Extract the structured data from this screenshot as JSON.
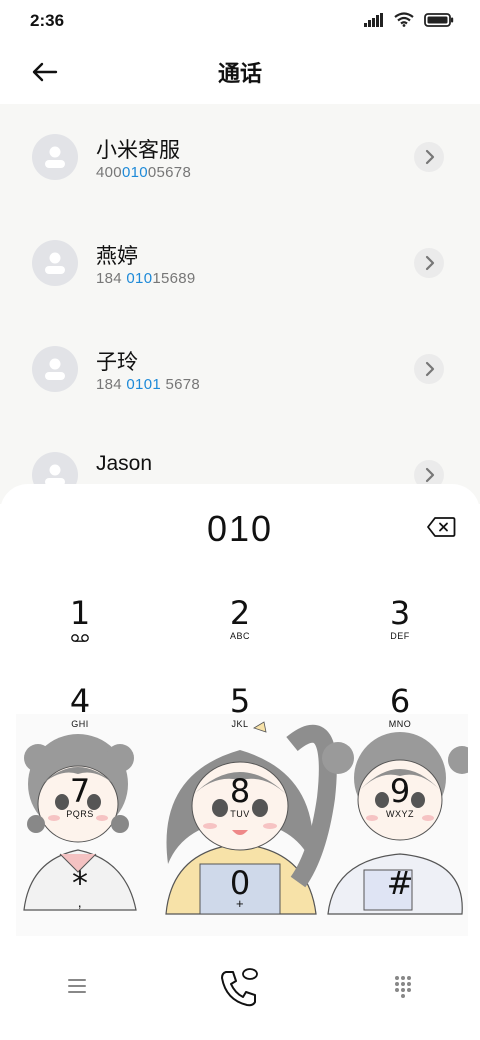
{
  "status": {
    "time": "2:36"
  },
  "header": {
    "title": "通话"
  },
  "contacts": [
    {
      "name": "小米客服",
      "num_pre": "400",
      "num_hl": "010",
      "num_post": "05678"
    },
    {
      "name": "燕婷",
      "num_pre": "184 ",
      "num_hl": "010",
      "num_post": "15689"
    },
    {
      "name": "子玲",
      "num_pre": "184 ",
      "num_hl": "0101",
      "num_post": " 5678"
    },
    {
      "name": "Jason",
      "num_pre": "",
      "num_hl": "",
      "num_post": ""
    }
  ],
  "dialer": {
    "input": "010",
    "keys": [
      {
        "digit": "1",
        "letters": ""
      },
      {
        "digit": "2",
        "letters": "ABC"
      },
      {
        "digit": "3",
        "letters": "DEF"
      },
      {
        "digit": "4",
        "letters": "GHI"
      },
      {
        "digit": "5",
        "letters": "JKL"
      },
      {
        "digit": "6",
        "letters": "MNO"
      },
      {
        "digit": "7",
        "letters": "PQRS"
      },
      {
        "digit": "8",
        "letters": "TUV"
      },
      {
        "digit": "9",
        "letters": "WXYZ"
      },
      {
        "digit": "*",
        "letters": ","
      },
      {
        "digit": "0",
        "letters": "+"
      },
      {
        "digit": "#",
        "letters": ""
      }
    ]
  },
  "icons": {
    "back": "back-arrow-icon",
    "backspace": "backspace-icon",
    "menu": "menu-icon",
    "call": "call-icon",
    "keypad": "keypad-icon"
  },
  "colors": {
    "highlight": "#1e8ad8",
    "list_bg": "#f7f7f5"
  }
}
